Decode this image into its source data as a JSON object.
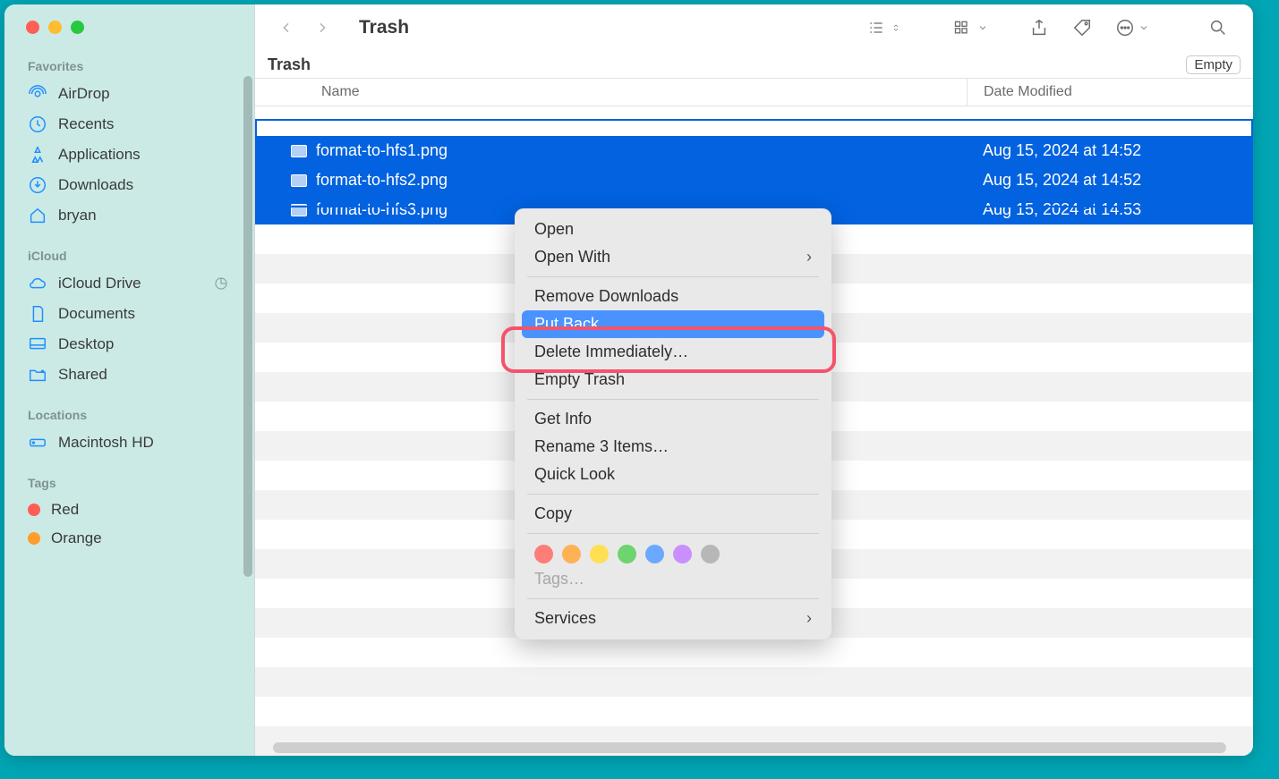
{
  "window_title": "Trash",
  "sidebar": {
    "sections": [
      {
        "header": "Favorites",
        "items": [
          {
            "label": "AirDrop",
            "icon": "airdrop-icon"
          },
          {
            "label": "Recents",
            "icon": "clock-icon"
          },
          {
            "label": "Applications",
            "icon": "apps-icon"
          },
          {
            "label": "Downloads",
            "icon": "download-icon"
          },
          {
            "label": "bryan",
            "icon": "home-icon"
          }
        ]
      },
      {
        "header": "iCloud",
        "items": [
          {
            "label": "iCloud Drive",
            "icon": "cloud-icon"
          },
          {
            "label": "Documents",
            "icon": "doc-icon"
          },
          {
            "label": "Desktop",
            "icon": "desktop-icon"
          },
          {
            "label": "Shared",
            "icon": "shared-folder-icon"
          }
        ]
      },
      {
        "header": "Locations",
        "items": [
          {
            "label": "Macintosh HD",
            "icon": "disk-icon"
          }
        ]
      },
      {
        "header": "Tags",
        "items": [
          {
            "label": "Red",
            "color": "#ff5d55"
          },
          {
            "label": "Orange",
            "color": "#ff9e2c"
          }
        ]
      }
    ]
  },
  "subheader_title": "Trash",
  "empty_button": "Empty",
  "columns": {
    "name": "Name",
    "date": "Date Modified"
  },
  "files": [
    {
      "name": "format-to-hfs1.png",
      "date": "Aug 15, 2024 at 14:52",
      "selected": true
    },
    {
      "name": "format-to-hfs2.png",
      "date": "Aug 15, 2024 at 14:52",
      "selected": true
    },
    {
      "name": "format-to-hfs3.png",
      "date": "Aug 15, 2024 at 14:53",
      "selected": true
    }
  ],
  "context_menu": {
    "items": [
      {
        "label": "Open",
        "type": "item"
      },
      {
        "label": "Open With",
        "type": "submenu"
      },
      {
        "type": "divider"
      },
      {
        "label": "Remove Downloads",
        "type": "item"
      },
      {
        "label": "Put Back",
        "type": "item",
        "highlighted": true
      },
      {
        "label": "Delete Immediately…",
        "type": "item"
      },
      {
        "label": "Empty Trash",
        "type": "item"
      },
      {
        "type": "divider"
      },
      {
        "label": "Get Info",
        "type": "item"
      },
      {
        "label": "Rename 3 Items…",
        "type": "item"
      },
      {
        "label": "Quick Look",
        "type": "item"
      },
      {
        "type": "divider"
      },
      {
        "label": "Copy",
        "type": "item"
      },
      {
        "type": "divider"
      },
      {
        "type": "tags",
        "colors": [
          "#ff7d78",
          "#ffb255",
          "#ffe053",
          "#6ed46e",
          "#6aa9ff",
          "#c98fff",
          "#b7b7b7"
        ]
      },
      {
        "label": "Tags…",
        "type": "item",
        "disabled": true
      },
      {
        "type": "divider"
      },
      {
        "label": "Services",
        "type": "submenu"
      }
    ]
  },
  "highlight_annotation_target": "Put Back"
}
